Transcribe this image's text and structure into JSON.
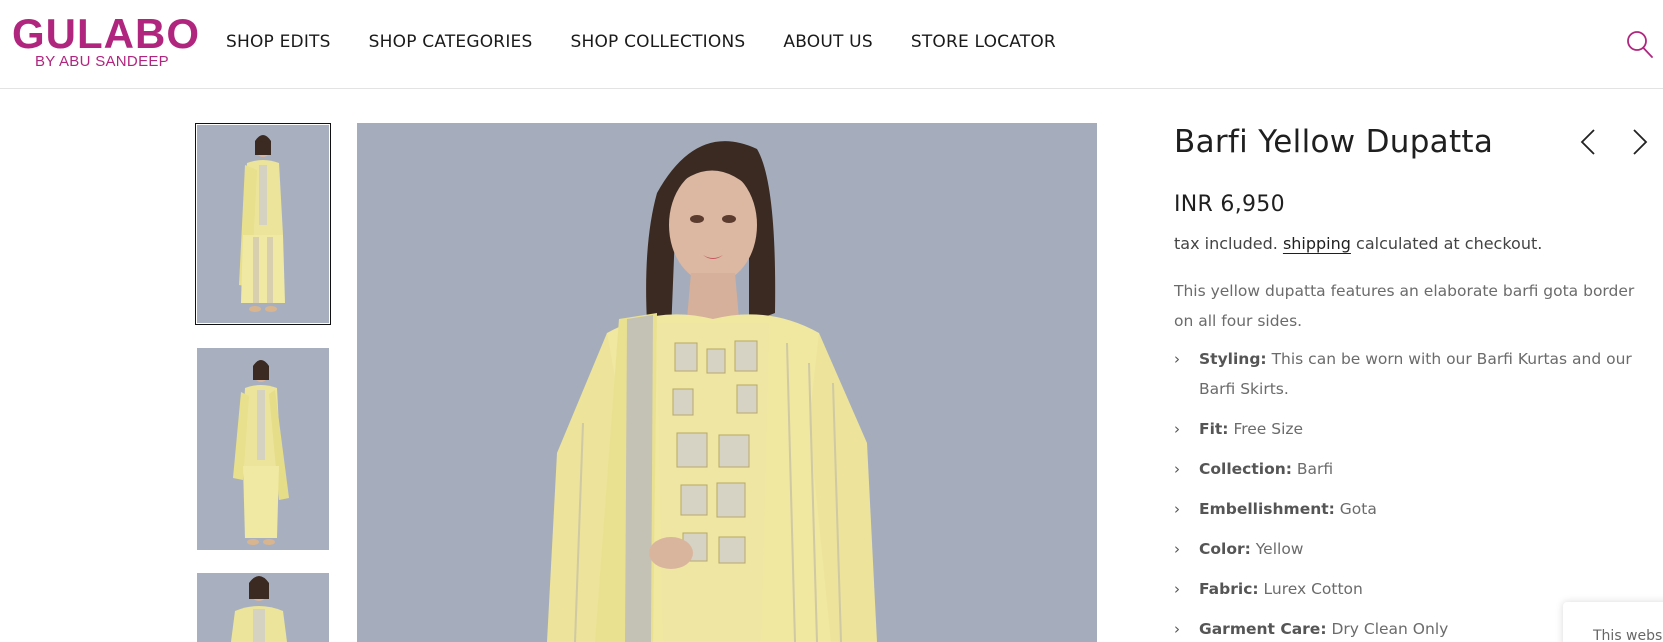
{
  "brand": {
    "name": "GULABO",
    "tagline": "BY ABU SANDEEP",
    "color": "#b0267f"
  },
  "nav": {
    "items": [
      {
        "label": "SHOP EDITS"
      },
      {
        "label": "SHOP CATEGORIES"
      },
      {
        "label": "SHOP COLLECTIONS"
      },
      {
        "label": "ABOUT US"
      },
      {
        "label": "STORE LOCATOR"
      }
    ],
    "search_icon": "search-icon"
  },
  "gallery": {
    "thumbnails": [
      "product-photo-front",
      "product-photo-side",
      "product-photo-closeup"
    ],
    "active_index": 0,
    "main_image": "product-photo-main"
  },
  "product": {
    "title": "Barfi Yellow Dupatta",
    "price": "INR 6,950",
    "tax_prefix": "tax included.",
    "shipping_link": "shipping",
    "tax_suffix": "calculated at checkout.",
    "description": "This yellow dupatta features an elaborate barfi gota border on all four sides.",
    "specs": [
      {
        "label": "Styling:",
        "value": "This can be worn with our Barfi Kurtas and our Barfi Skirts."
      },
      {
        "label": "Fit:",
        "value": "Free Size"
      },
      {
        "label": "Collection:",
        "value": "Barfi"
      },
      {
        "label": "Embellishment:",
        "value": "Gota"
      },
      {
        "label": "Color:",
        "value": "Yellow"
      },
      {
        "label": "Fabric:",
        "value": "Lurex Cotton"
      },
      {
        "label": "Garment Care:",
        "value": "Dry Clean Only"
      }
    ]
  },
  "corner_widget": {
    "text": "This webs"
  }
}
